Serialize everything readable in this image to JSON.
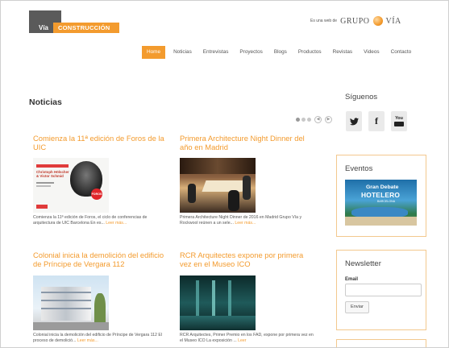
{
  "header": {
    "logo_via": "Vía",
    "logo_construccion": "CONSTRUCCIÓN",
    "group_prefix": "Es una web de",
    "group_brand_a": "GRUPO",
    "group_brand_b": "VÍA"
  },
  "nav": {
    "items": [
      {
        "label": "Home",
        "active": true
      },
      {
        "label": "Noticias"
      },
      {
        "label": "Entrevistas"
      },
      {
        "label": "Proyectos"
      },
      {
        "label": "Blogs"
      },
      {
        "label": "Productos"
      },
      {
        "label": "Revistas"
      },
      {
        "label": "Videos"
      },
      {
        "label": "Contacto"
      }
    ]
  },
  "main": {
    "section_title": "Noticias",
    "cards": [
      {
        "title": "Comienza la 11ª edición de Foros de la UIC",
        "desc": "Comienza la 11ª edición de Foros, el ciclo de conferencias de arquitectura de UIC Barcelona En es...",
        "more": "Leer más...",
        "img_text_a": "Christoph Hölscher",
        "img_text_b": "& Victor Schmid",
        "img_badge": "FOROS"
      },
      {
        "title": "Primera Architecture Night Dinner del año en Madrid",
        "desc": "Primera Architecture Night Dinner de 2016 en Madrid Grupo Vía y Rockwool reúnen a un sele...",
        "more": "Leer más..."
      },
      {
        "title": "Colonial inicia la demolición del edificio de Príncipe de Vergara 112",
        "desc": "Colonial inicia la demolición del edificio de Príncipe de Vergara 112 El proceso de demolició...",
        "more": "Leer más..."
      },
      {
        "title": "RCR Arquitectes expone por primera vez en el Museo ICO",
        "desc": "RCR Arquitectes, Primer Premio en los FAD, expone por primera vez en el Museo ICO La exposición ...",
        "more": "Leer"
      }
    ]
  },
  "sidebar": {
    "follow_title": "Síguenos",
    "social": [
      {
        "icon": "twitter-icon",
        "glyph": "🐦"
      },
      {
        "icon": "facebook-icon",
        "glyph": "f"
      },
      {
        "icon": "youtube-icon",
        "glyph": "You"
      }
    ],
    "events_title": "Eventos",
    "event_banner_a": "Gran Debate",
    "event_banner_b": "HOTELERO",
    "event_banner_c": "BARCELONA",
    "newsletter_title": "Newsletter",
    "email_label": "Email",
    "send_label": "Enviar"
  },
  "colors": {
    "accent": "#f39b2e",
    "dark": "#5a5a5a"
  }
}
